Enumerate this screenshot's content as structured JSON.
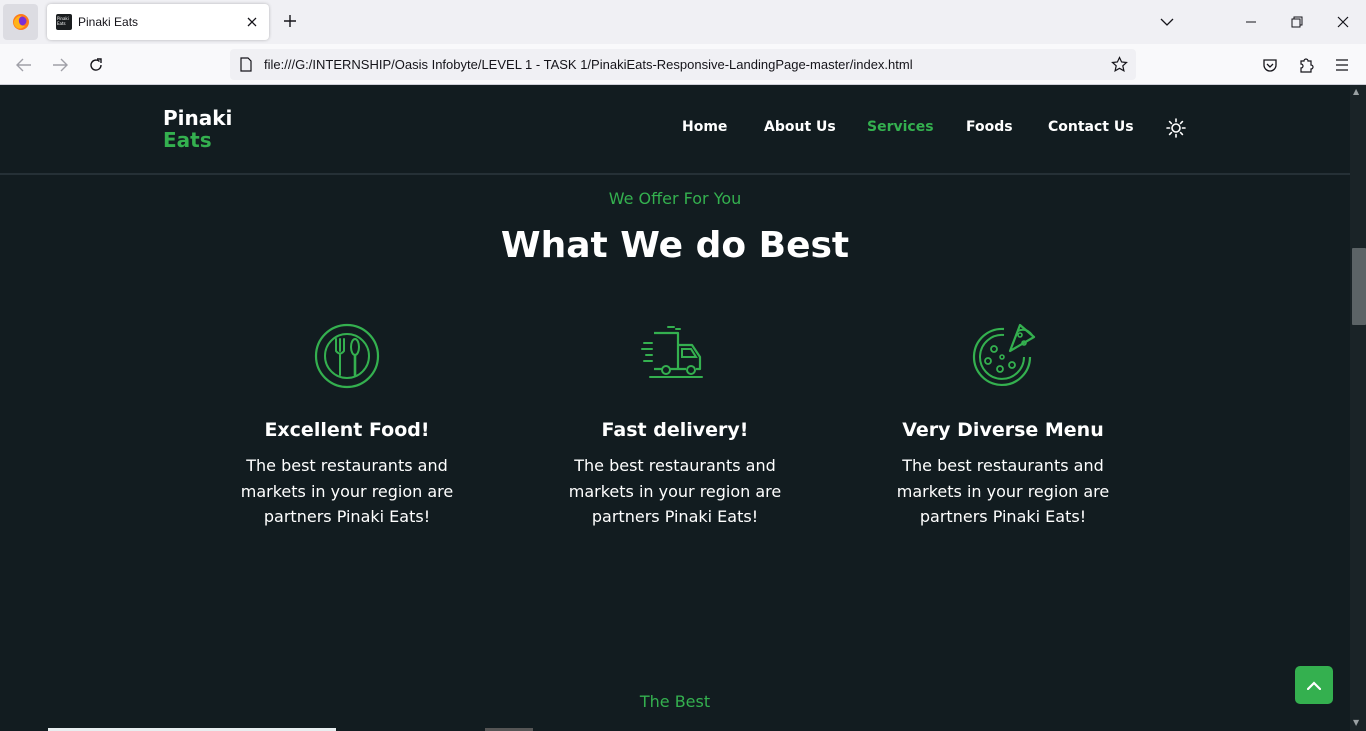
{
  "browser": {
    "tab_title": "Pinaki Eats",
    "tab_favicon_text": "Pinaki Eats",
    "url": "file:///G:/INTERNSHIP/Oasis Infobyte/LEVEL 1 - TASK 1/PinakiEats-Responsive-LandingPage-master/index.html"
  },
  "site": {
    "logo_line1": "Pinaki",
    "logo_line2": "Eats",
    "menu": [
      {
        "label": "Home",
        "active": false
      },
      {
        "label": "About Us",
        "active": false
      },
      {
        "label": "Services",
        "active": true
      },
      {
        "label": "Foods",
        "active": false
      },
      {
        "label": "Contact Us",
        "active": false
      }
    ]
  },
  "services": {
    "subtitle": "We Offer For You",
    "title": "What We do Best",
    "cards": [
      {
        "icon": "utensils-icon",
        "title": "Excellent Food!",
        "text": "The best restaurants and markets in your region are partners Pinaki Eats!"
      },
      {
        "icon": "delivery-truck-icon",
        "title": "Fast delivery!",
        "text": "The best restaurants and markets in your region are partners Pinaki Eats!"
      },
      {
        "icon": "pizza-icon",
        "title": "Very Diverse Menu",
        "text": "The best restaurants and markets in your region are partners Pinaki Eats!"
      }
    ]
  },
  "next_section": {
    "subtitle": "The Best"
  },
  "colors": {
    "page_bg": "#121c20",
    "accent": "#34b04f",
    "text": "#ffffff"
  }
}
